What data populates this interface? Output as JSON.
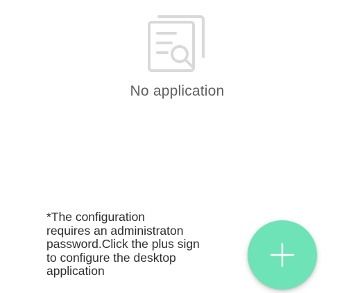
{
  "empty_state": {
    "icon": "document-search-icon",
    "message": "No application"
  },
  "hint": {
    "text": "*The configuration\nrequires an administraton\npassword.Click the plus sign\nto configure the desktop\napplication"
  },
  "add_button": {
    "icon": "plus-icon"
  },
  "colors": {
    "accent": "#6de3b7",
    "icon_gray": "#d9d9d9",
    "text_gray": "#5f5f5f",
    "hint_text": "#2d2d2d"
  }
}
